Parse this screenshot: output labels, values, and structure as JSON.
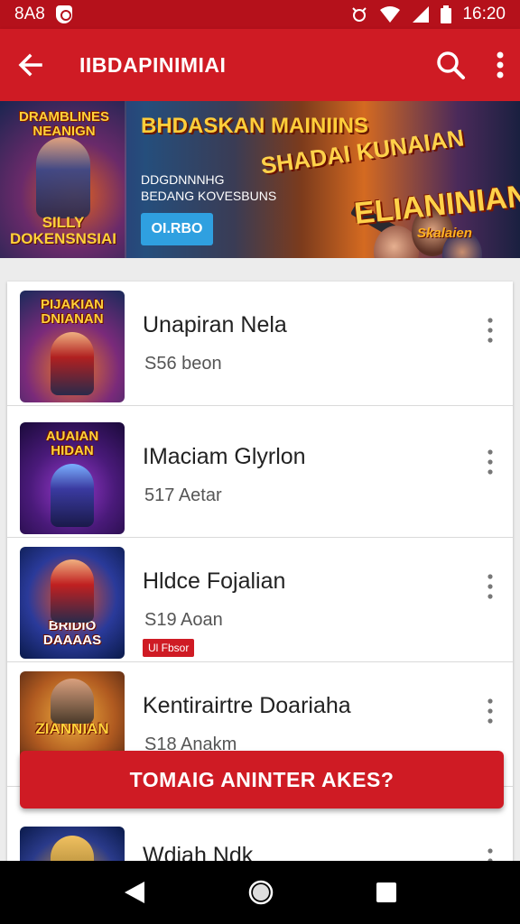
{
  "status_bar": {
    "time_left": "8A8",
    "time_right": "16:20"
  },
  "app_bar": {
    "title": "IIBDAPINIMIAI"
  },
  "banner": {
    "left_title": "DRAMBLINES NEANIGN",
    "left_subtitle": "SILLY DOKENSNSIAI",
    "mid_title": "BHDASKAN MAINIINS",
    "mid_text_1": "DDGDNNNHG",
    "mid_text_2": "BEDANG KOVESBUNS",
    "button_label": "OI.RBO",
    "right_title": "SHADAI KUNAIAN",
    "main_title": "ELIANINIAN",
    "main_subtitle": "Skalaien"
  },
  "list": {
    "items": [
      {
        "title": "Unapiran Nela",
        "subtitle": "S56 beon",
        "thumb_text": "PIJAKIAN DNIANAN",
        "badge": ""
      },
      {
        "title": "IMaciam Glyrlon",
        "subtitle": "517 Aetar",
        "thumb_text": "AUAIAN HIDAN",
        "badge": ""
      },
      {
        "title": "Hldce Fojalian",
        "subtitle": "S19 Aoan",
        "thumb_text": "BRIDIO DAAAAS",
        "badge": "Ul Fbsor"
      },
      {
        "title": "Kentirairtre Doariaha",
        "subtitle": "S18 Anakm",
        "thumb_text": "ZIANNIAN",
        "badge": ""
      },
      {
        "title": "Wdiah Ndk",
        "subtitle": "",
        "thumb_text": "",
        "badge": ""
      }
    ]
  },
  "cta": {
    "label": "TOMAIG ANINTER AKES?"
  },
  "colors": {
    "primary": "#cf1b24",
    "status": "#b5111b"
  },
  "icons": [
    "back-arrow-icon",
    "search-icon",
    "more-vert-icon",
    "alarm-icon",
    "wifi-icon",
    "signal-icon",
    "battery-icon",
    "shield-icon",
    "nav-back-icon",
    "nav-home-icon",
    "nav-recents-icon"
  ]
}
